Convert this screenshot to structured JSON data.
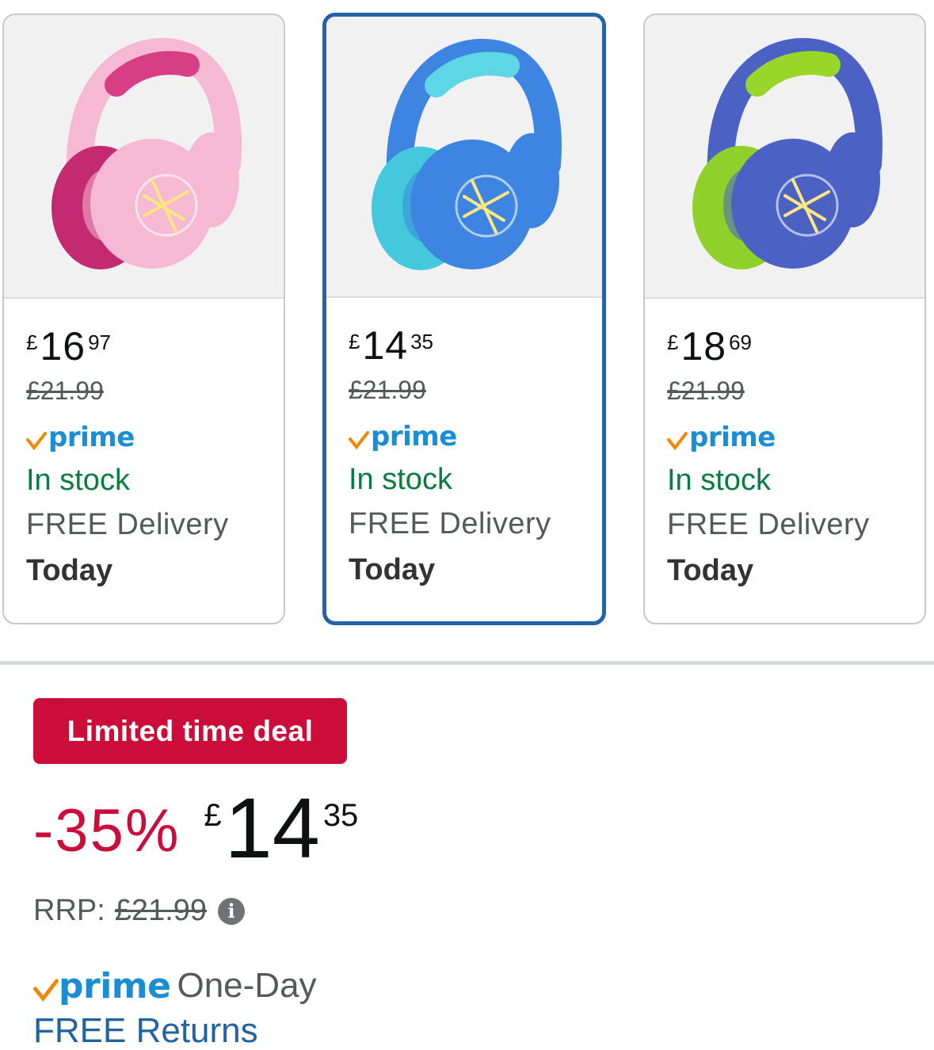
{
  "variants": [
    {
      "currency": "£",
      "whole": "16",
      "fraction": "97",
      "was": "£21.99",
      "prime": "prime",
      "stock": "In stock",
      "delivery": "FREE Delivery",
      "delivery_day": "Today",
      "colors": {
        "main": "#f6b9d3",
        "accent": "#d63f86",
        "cushion": "#c42a72"
      }
    },
    {
      "currency": "£",
      "whole": "14",
      "fraction": "35",
      "was": "£21.99",
      "prime": "prime",
      "stock": "In stock",
      "delivery": "FREE Delivery",
      "delivery_day": "Today",
      "selected": true,
      "colors": {
        "main": "#3d85e0",
        "accent": "#5fd6e6",
        "cushion": "#44c8dc"
      }
    },
    {
      "currency": "£",
      "whole": "18",
      "fraction": "69",
      "was": "£21.99",
      "prime": "prime",
      "stock": "In stock",
      "delivery": "FREE Delivery",
      "delivery_day": "Today",
      "colors": {
        "main": "#4b62c4",
        "accent": "#9ad62a",
        "cushion": "#8fd02a"
      }
    }
  ],
  "deal": {
    "badge": "Limited time deal",
    "discount": "-35%",
    "currency": "£",
    "whole": "14",
    "fraction": "35",
    "rrp_label": "RRP:",
    "rrp_value": "£21.99",
    "info_icon": "i",
    "prime": "prime",
    "prime_suffix": "One-Day",
    "returns": "FREE Returns"
  },
  "colors": {
    "prime_blue": "#1a8ed4",
    "prime_check": "#f08804",
    "deal_red": "#cc0c39",
    "in_stock_green": "#067d3e",
    "selected_border": "#2563a8",
    "link_blue": "#2162a1"
  }
}
